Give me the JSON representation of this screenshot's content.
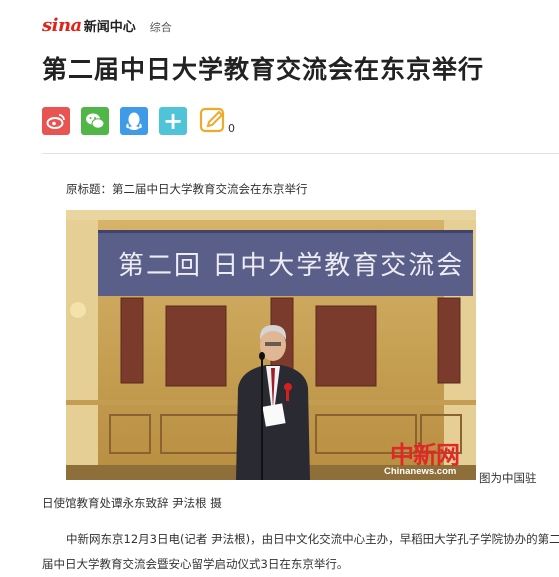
{
  "header": {
    "logo_brand": "sina",
    "logo_text": "新闻中心",
    "channel": "综合"
  },
  "article": {
    "title": "第二届中日大学教育交流会在东京举行",
    "original_title": "原标题：第二届中日大学教育交流会在东京举行",
    "photo": {
      "banner_text": "第二回 日中大学教育交流会",
      "watermark_cn": "中新网",
      "watermark_en": "Chinanews.com"
    },
    "caption_part1": "图为中国驻",
    "caption_part2": "日使馆教育处谭永东致辞 尹法根 摄",
    "paragraph": "中新网东京12月3日电(记者 尹法根)，由日中文化交流中心主办，早稻田大学孔子学院协办的第二届中日大学教育交流会暨安心留学启动仪式3日在东京举行。"
  },
  "share": {
    "icons": [
      "weibo-icon",
      "wechat-icon",
      "qq-icon",
      "plus-icon",
      "edit-comment-icon"
    ],
    "comment_count": "0",
    "colors": {
      "weibo": "#e8544f",
      "wechat": "#50b648",
      "qq": "#3f9ae8",
      "plus": "#4fc3d8",
      "comment": "#f0a92a"
    }
  }
}
